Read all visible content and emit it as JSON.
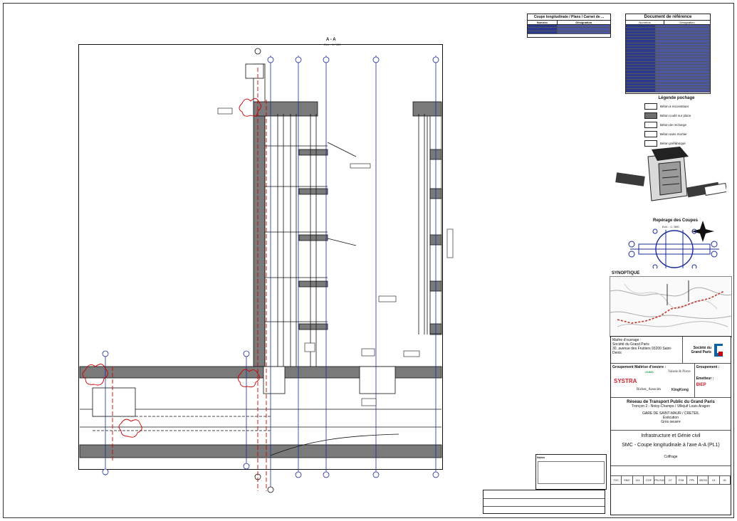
{
  "drawing": {
    "section_title": "A - A",
    "section_scale": "Ech. : 1 / 100"
  },
  "top_table": {
    "title": "Coupe longitudinale / Plans / Carnet de ...",
    "col1": "Numéro",
    "col2": "Désignation"
  },
  "references": {
    "title": "Document de référence",
    "col1": "Numéros",
    "col2": "Désignation",
    "row_count": 22
  },
  "legend": {
    "title": "Légende pochage",
    "items": [
      {
        "label": "Béton à reconstituer",
        "color": "#ffffff"
      },
      {
        "label": "Béton coulé sur place",
        "color": "#6f6f6f"
      },
      {
        "label": "Béton de recharge",
        "color": "#ffffff"
      },
      {
        "label": "Béton sans mortier",
        "color": "#ffffff"
      },
      {
        "label": "Béton préfabriqué",
        "color": "#ffffff"
      }
    ]
  },
  "reperage": {
    "title": "Repérage des Coupes",
    "scale": "Ech. : 1 / 500"
  },
  "synoptique": {
    "title": "SYNOPTIQUE"
  },
  "title_block": {
    "owner_label": "Maître d'ouvrage :",
    "owner_name": "Société du Grand Paris",
    "owner_address": "30, avenue des Fruitiers 93200 Saint-Denis",
    "sgp_logo": "Société du Grand Paris",
    "group_label": "Groupement Maîtrise d'oeuvre :",
    "group_label2": "Groupement :",
    "emitter_label": "Emetteur :",
    "firm_systra": "SYSTRA",
    "firm_valode": "Valode & Pistre",
    "firm_riches": "Richez_Associés",
    "firm_kingkong": "KingKong",
    "firm_biep": "BIEP",
    "firm_anma": "ANMA",
    "network_title": "Réseau de Transport Public du Grand Paris",
    "troncon": "Tronçon 2 - Noisy-Champs / Villejuif Louis Aragon",
    "gare": "GARE DE SAINT-MAUR / CRETEIL",
    "phase": "Exécution",
    "lot": "Gros oeuvre",
    "discipline": "Infrastructure et Génie civil",
    "sheet_title": "SMC - Coupe longitudinale à l'axe A-A (PL1)",
    "sheet_subtitle": "Coffrage",
    "codes": [
      "T2C",
      "SMC",
      "111",
      "COF",
      "PN-S42",
      "07",
      "P28",
      "FPL",
      "33233",
      "01",
      "01"
    ]
  },
  "notes": {
    "label": "Notes"
  }
}
